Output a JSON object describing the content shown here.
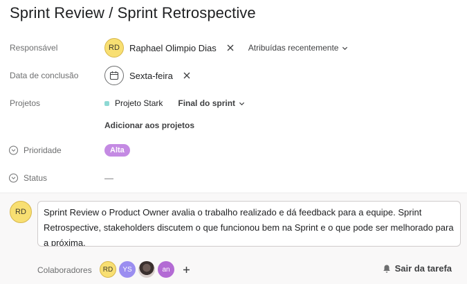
{
  "task": {
    "title": "Sprint Review / Sprint Retrospective"
  },
  "fields": {
    "assignee": {
      "label": "Responsável",
      "avatar_initials": "RD",
      "name": "Raphael Olimpio Dias",
      "recent_dropdown": "Atribuídas recentemente"
    },
    "due_date": {
      "label": "Data de conclusão",
      "value": "Sexta-feira"
    },
    "projects": {
      "label": "Projetos",
      "project_name": "Projeto Stark",
      "project_color": "#8ed9d4",
      "section": "Final do sprint",
      "add_label": "Adicionar aos projetos"
    },
    "priority": {
      "label": "Prioridade",
      "value": "Alta",
      "color": "#c48ae3"
    },
    "status": {
      "label": "Status",
      "value": "—"
    }
  },
  "comment": {
    "avatar_initials": "RD",
    "text": "Sprint Review o Product Owner avalia o trabalho realizado e dá feedback para a equipe. Sprint Retrospective, stakeholders discutem o que funcionou bem na Sprint e o que pode ser melhorado para a próxima."
  },
  "collaborators": {
    "label": "Colaboradores",
    "people": [
      {
        "initials": "RD",
        "color": "#f8df72"
      },
      {
        "initials": "YS",
        "color": "#9b8ef0"
      },
      {
        "initials": "",
        "color": "#6b5a55"
      },
      {
        "initials": "an",
        "color": "#b36bd4"
      }
    ]
  },
  "actions": {
    "leave_task": "Sair da tarefa"
  }
}
